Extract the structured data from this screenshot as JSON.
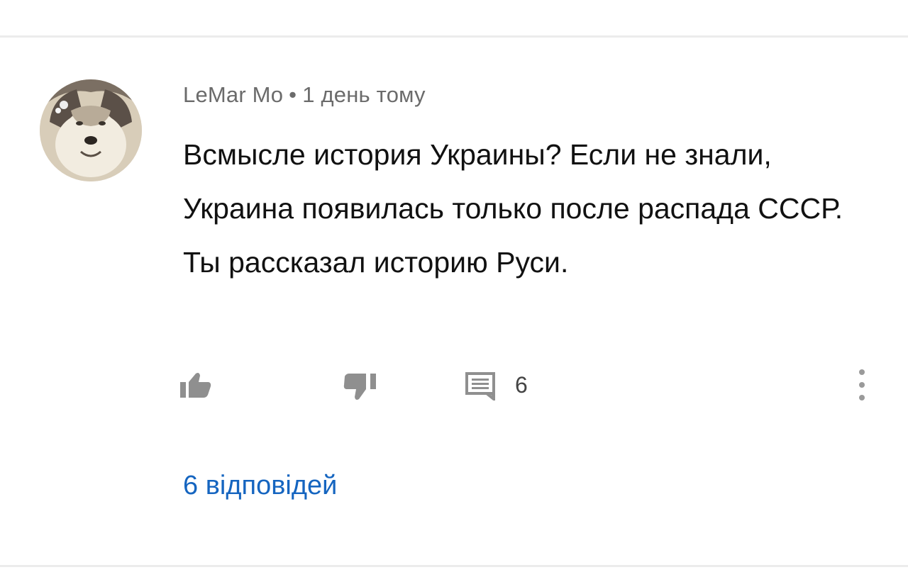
{
  "comment": {
    "author": "LeMar Mo",
    "separator": "•",
    "timestamp": "1 день тому",
    "text": "Всмысле история Украины? Если не знали, Украина появилась только после распада СССР. Ты рассказал историю Руси.",
    "actions": {
      "like_icon": "thumb-up-icon",
      "dislike_icon": "thumb-down-icon",
      "replies_icon": "comment-icon",
      "reply_count": "6",
      "menu_icon": "more-vert-icon"
    },
    "view_replies_label": "6 відповідей"
  },
  "colors": {
    "link": "#1565c0",
    "meta_text": "#6b6b6b",
    "icon": "#8f8f8f"
  }
}
